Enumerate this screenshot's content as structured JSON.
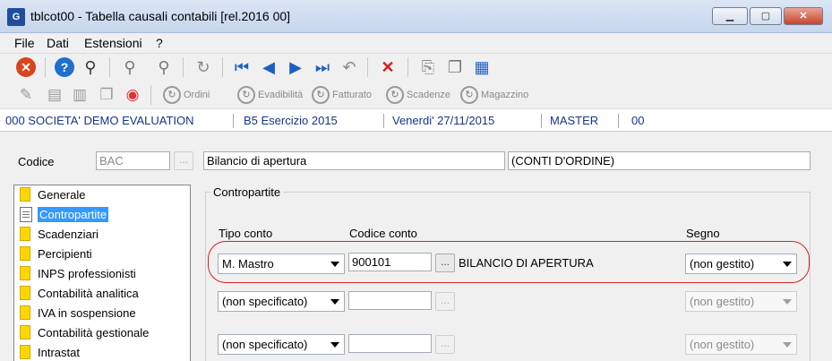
{
  "window": {
    "title": "tblcot00 - Tabella causali contabili  [rel.2016 00]",
    "logo": "G"
  },
  "menu": [
    "File",
    "Dati",
    "Estensioni",
    "?"
  ],
  "toolbar2": {
    "ordini": "Ordini",
    "evadibilita": "Evadibilità",
    "fatturato": "Fatturato",
    "scadenze": "Scadenze",
    "magazzino": "Magazzino"
  },
  "status": {
    "company": "000 SOCIETA' DEMO EVALUATION",
    "year": "B5 Esercizio 2015",
    "date": "Venerdi' 27/11/2015",
    "user": "MASTER",
    "code": "00"
  },
  "form": {
    "codice_label": "Codice",
    "codice_value": "BAC",
    "descrizione": "Bilancio di apertura",
    "descrizione2": "(CONTI D'ORDINE)",
    "dots": "..."
  },
  "tree": [
    "Generale",
    "Contropartite",
    "Scadenziari",
    "Percipienti",
    "INPS professionisti",
    "Contabilità analitica",
    "IVA in sospensione",
    "Contabilità gestionale",
    "Intrastat"
  ],
  "contropartite": {
    "group_label": "Contropartite",
    "col_tipo": "Tipo conto",
    "col_codice": "Codice conto",
    "col_segno": "Segno",
    "rows": [
      {
        "tipo": "M. Mastro",
        "codice": "900101",
        "descr": "BILANCIO DI APERTURA",
        "segno": "(non gestito)"
      },
      {
        "tipo": "(non specificato)",
        "codice": "",
        "descr": "",
        "segno": "(non gestito)"
      },
      {
        "tipo": "(non specificato)",
        "codice": "",
        "descr": "",
        "segno": "(non gestito)"
      }
    ]
  },
  "colors": {
    "status_text": "#17358a",
    "highlight": "#d42020",
    "selection": "#3399ff"
  }
}
